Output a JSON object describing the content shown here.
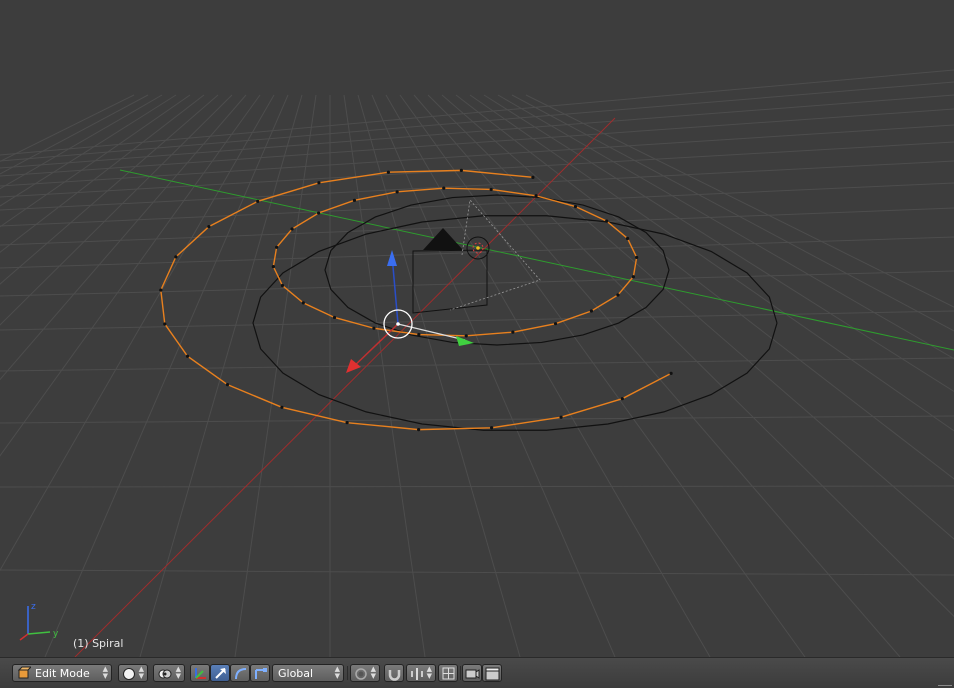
{
  "viewport": {
    "object_label": "(1) Spiral",
    "axis_labels": {
      "z": "z",
      "y": "y"
    }
  },
  "header": {
    "mode": {
      "label": "Edit Mode",
      "icon": "cube-edit-icon"
    },
    "shading": {
      "icon": "sphere-solid-icon"
    },
    "pivot": {
      "icon": "pivot-point-icon"
    },
    "manipulators": [
      {
        "name": "manipulator-toggle",
        "icon": "axes-icon"
      },
      {
        "name": "translate",
        "icon": "arrow-icon",
        "active": true
      },
      {
        "name": "rotate",
        "icon": "arc-icon"
      },
      {
        "name": "scale",
        "icon": "scale-icon"
      }
    ],
    "orientation": {
      "label": "Global"
    },
    "proportional_edit": {
      "icon": "circle-dot-icon"
    },
    "snap": {
      "icon": "magnet-icon"
    },
    "render_icons": [
      "mirror-icon",
      "snap-target-icon",
      "camera-icon",
      "clapper-icon"
    ]
  },
  "colors": {
    "viewport_bg": "#3d3d3d",
    "grid": "#4d4d4d",
    "x_axis": "#a12c2c",
    "y_axis": "#2e9c2e",
    "selected_curve": "#e8801e",
    "curve": "#111111"
  }
}
